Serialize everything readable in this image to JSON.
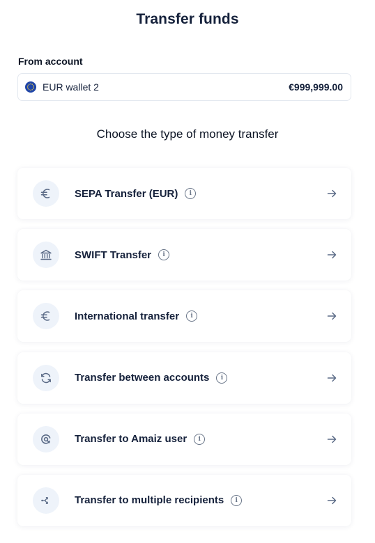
{
  "page": {
    "title": "Transfer funds"
  },
  "from_account": {
    "label": "From account",
    "name": "EUR wallet 2",
    "balance": "€999,999.00",
    "flag_icon": "eu-flag-icon"
  },
  "subtitle": "Choose the type of money transfer",
  "options": [
    {
      "label": "SEPA Transfer (EUR)",
      "icon": "euro-icon"
    },
    {
      "label": "SWIFT Transfer",
      "icon": "bank-icon"
    },
    {
      "label": "International transfer",
      "icon": "euro-icon"
    },
    {
      "label": "Transfer between accounts",
      "icon": "refresh-icon"
    },
    {
      "label": "Transfer to Amaiz user",
      "icon": "amaiz-logo-icon"
    },
    {
      "label": "Transfer to multiple recipients",
      "icon": "split-arrows-icon"
    }
  ],
  "colors": {
    "icon_bg": "#eef3fa",
    "icon_stroke": "#5a6a86",
    "text": "#15213b"
  }
}
